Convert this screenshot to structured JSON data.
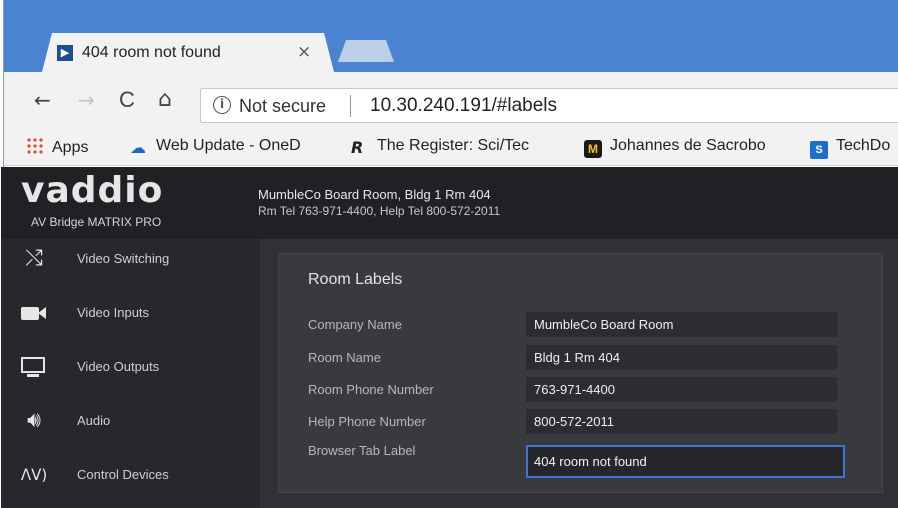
{
  "browser": {
    "tab": {
      "title": "404 room not found",
      "close": "×",
      "favicon": "vaddio-favicon"
    },
    "toolbar": {
      "back": "←",
      "forward": "→",
      "reload": "C",
      "home": "⌂"
    },
    "omnibox": {
      "security_icon": "info-icon",
      "security_label": "Not secure",
      "url": "10.30.240.191/#labels"
    },
    "bookmarks": [
      {
        "label": "Apps",
        "icon": "apps-grid-icon"
      },
      {
        "label": "Web Update - OneD",
        "icon": "cloud-icon"
      },
      {
        "label": "The Register: Sci/Tec",
        "icon": "register-icon"
      },
      {
        "label": "Johannes de Sacrobo",
        "icon": "mizzou-icon"
      },
      {
        "label": "TechDo",
        "icon": "sharepoint-icon"
      }
    ]
  },
  "app": {
    "logo": "vaddio",
    "product": "AV Bridge MATRIX PRO",
    "room_line1": "MumbleCo Board Room, Bldg 1 Rm 404",
    "room_line2": "Rm Tel 763-971-4400, Help Tel 800-572-2011",
    "nav": [
      {
        "label": "Video Switching",
        "icon": "shuffle-icon"
      },
      {
        "label": "Video Inputs",
        "icon": "camera-icon"
      },
      {
        "label": "Video Outputs",
        "icon": "monitor-icon"
      },
      {
        "label": "Audio",
        "icon": "speaker-icon"
      },
      {
        "label": "Control Devices",
        "icon": "control-signal-icon"
      }
    ],
    "panel": {
      "title": "Room Labels",
      "fields": [
        {
          "label": "Company Name",
          "value": "MumbleCo Board Room"
        },
        {
          "label": "Room Name",
          "value": "Bldg 1 Rm 404"
        },
        {
          "label": "Room Phone Number",
          "value": "763-971-4400"
        },
        {
          "label": "Help Phone Number",
          "value": "800-572-2011"
        },
        {
          "label": "Browser Tab Label",
          "value": "404 room not found"
        }
      ]
    }
  }
}
